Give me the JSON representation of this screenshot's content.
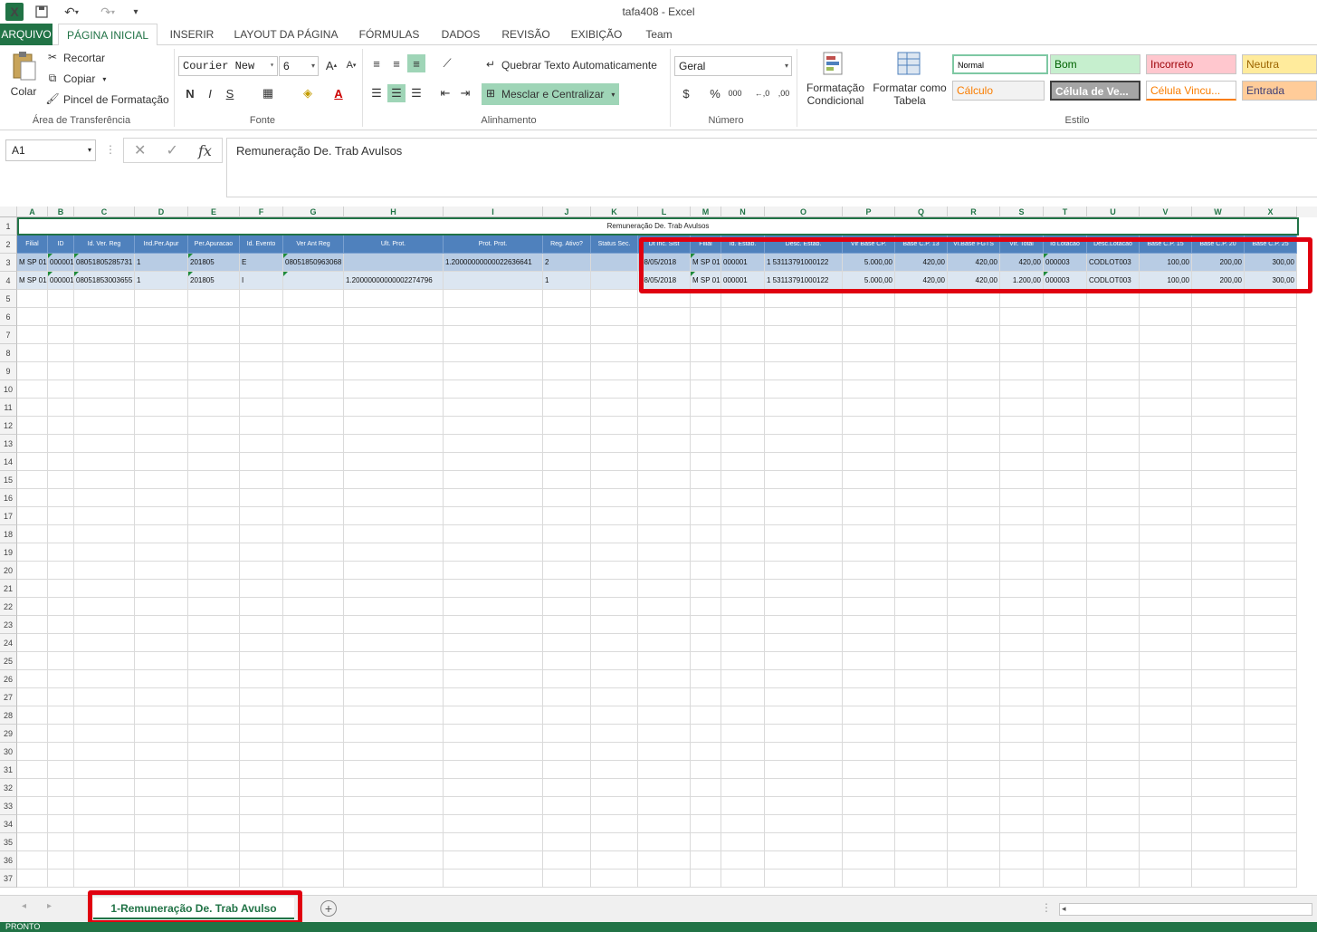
{
  "window": {
    "title": "tafa408 - Excel",
    "app_logo": "X"
  },
  "quick_access": {
    "save_icon": "save-icon",
    "undo_icon": "undo-icon",
    "redo_icon": "redo-icon"
  },
  "ribbon_tabs": [
    "ARQUIVO",
    "PÁGINA INICIAL",
    "INSERIR",
    "LAYOUT DA PÁGINA",
    "FÓRMULAS",
    "DADOS",
    "REVISÃO",
    "EXIBIÇÃO",
    "Team"
  ],
  "clipboard": {
    "paste": "Colar",
    "cut": "Recortar",
    "copy": "Copiar",
    "format_painter": "Pincel de Formatação",
    "label": "Área de Transferência"
  },
  "font": {
    "name": "Courier New",
    "size": "6",
    "bold": "N",
    "italic": "I",
    "underline": "S",
    "label": "Fonte"
  },
  "alignment": {
    "wrap": "Quebrar Texto Automaticamente",
    "merge": "Mesclar e Centralizar",
    "label": "Alinhamento"
  },
  "number": {
    "format": "Geral",
    "percent": "%",
    "thousands": "000",
    "label": "Número"
  },
  "styles": {
    "conditional": [
      "Formatação",
      "Condicional"
    ],
    "as_table": [
      "Formatar como",
      "Tabela"
    ],
    "cells": [
      {
        "label": "Normal",
        "bg": "#ffffff",
        "fg": "#000000"
      },
      {
        "label": "Bom",
        "bg": "#c6efce",
        "fg": "#006100"
      },
      {
        "label": "Incorreto",
        "bg": "#ffc7ce",
        "fg": "#9c0006"
      },
      {
        "label": "Neutra",
        "bg": "#ffeb9c",
        "fg": "#9c6500"
      },
      {
        "label": "Cálculo",
        "bg": "#f2f2f2",
        "fg": "#fa7d00"
      },
      {
        "label": "Célula de Ve...",
        "bg": "#a5a5a5",
        "fg": "#ffffff"
      },
      {
        "label": "Célula Vincu...",
        "bg": "#ffffff",
        "fg": "#fa7d00"
      },
      {
        "label": "Entrada",
        "bg": "#ffcc99",
        "fg": "#3f3f76"
      }
    ],
    "label": "Estilo"
  },
  "formula_bar": {
    "cell_ref": "A1",
    "content": "Remuneração De. Trab Avulsos"
  },
  "sheet": {
    "columns": [
      "A",
      "B",
      "C",
      "D",
      "E",
      "F",
      "G",
      "H",
      "I",
      "J",
      "K",
      "L",
      "M",
      "N",
      "O",
      "P",
      "Q",
      "R",
      "S",
      "T",
      "U",
      "V",
      "W",
      "X"
    ],
    "title": "Remuneração De. Trab Avulsos",
    "headers": [
      "Filial",
      "ID",
      "Id. Ver. Reg",
      "Ind.Per.Apur",
      "Per.Apuracao",
      "Id. Evento",
      "Ver Ant Reg",
      "Ult. Prot.",
      "Prot. Prot.",
      "Reg. Ativo?",
      "Status Sec.",
      "Dt Inc. Sist",
      "Filial",
      "Id. Estab.",
      "Desc. Estab.",
      "Vlr Base CP.",
      "Base C.P. 13",
      "Vl.Base FGTS",
      "Vlr. Total",
      "Id Lotacao",
      "Desc.Lotacao",
      "Base C.P. 15",
      "Base C.P. 20",
      "Base C.P. 25"
    ],
    "rows": [
      [
        "M SP 01",
        "000001",
        "08051805285731",
        "1",
        "201805",
        "E",
        "08051850963068",
        "",
        "1.20000000000022636641",
        "2",
        "",
        "08/05/2018",
        "M SP 01",
        "000001",
        "1  53113791000122",
        "5.000,00",
        "420,00",
        "420,00",
        "420,00",
        "000003",
        "CODLOT003",
        "100,00",
        "200,00",
        "300,00"
      ],
      [
        "M SP 01",
        "000001",
        "08051853003655",
        "1",
        "201805",
        "I",
        "",
        "1.20000000000002274796",
        "",
        "1",
        "",
        "08/05/2018",
        "M SP 01",
        "000001",
        "1  53113791000122",
        "5.000,00",
        "420,00",
        "420,00",
        "1.200,00",
        "000003",
        "CODLOT003",
        "100,00",
        "200,00",
        "300,00"
      ]
    ],
    "row_numbers": [
      "1",
      "2",
      "3",
      "4",
      "5",
      "6",
      "7",
      "8",
      "9",
      "10",
      "11",
      "12",
      "13",
      "14",
      "15",
      "16",
      "17",
      "18",
      "19",
      "20",
      "21",
      "22",
      "23",
      "24",
      "25",
      "26",
      "27",
      "28",
      "29",
      "30",
      "31",
      "32",
      "33",
      "34",
      "35",
      "36",
      "37"
    ]
  },
  "sheet_tabs": [
    "1-Remuneração De. Trab Avulso"
  ],
  "status": "PRONTO",
  "colors": {
    "excel_green": "#217346",
    "table_header": "#4f81bd",
    "highlight": "#e00010"
  }
}
